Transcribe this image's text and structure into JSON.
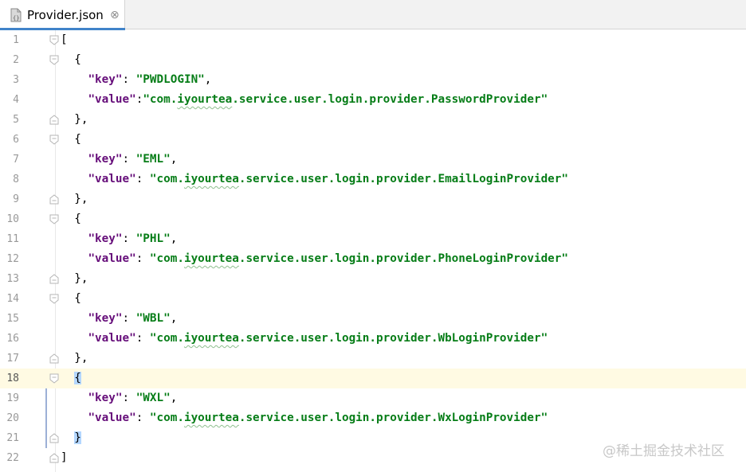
{
  "tab": {
    "filename": "Provider.json",
    "close": "⊗"
  },
  "lines": [
    {
      "n": "1",
      "t": [
        {
          "c": "p",
          "v": "["
        }
      ],
      "fold": "open"
    },
    {
      "n": "2",
      "t": [
        {
          "c": "p",
          "v": "  {"
        }
      ],
      "fold": "open"
    },
    {
      "n": "3",
      "t": [
        {
          "c": "p",
          "v": "    "
        },
        {
          "c": "k",
          "v": "\"key\""
        },
        {
          "c": "p",
          "v": ": "
        },
        {
          "c": "s",
          "v": "\"PWDLOGIN\""
        },
        {
          "c": "p",
          "v": ","
        }
      ]
    },
    {
      "n": "4",
      "t": [
        {
          "c": "p",
          "v": "    "
        },
        {
          "c": "k",
          "v": "\"value\""
        },
        {
          "c": "p",
          "v": ":"
        },
        {
          "c": "s",
          "v": "\"com."
        },
        {
          "c": "sw",
          "v": "iyourtea"
        },
        {
          "c": "s",
          "v": ".service.user.login.provider.PasswordProvider\""
        }
      ]
    },
    {
      "n": "5",
      "t": [
        {
          "c": "p",
          "v": "  },"
        }
      ],
      "fold": "close"
    },
    {
      "n": "6",
      "t": [
        {
          "c": "p",
          "v": "  {"
        }
      ],
      "fold": "open"
    },
    {
      "n": "7",
      "t": [
        {
          "c": "p",
          "v": "    "
        },
        {
          "c": "k",
          "v": "\"key\""
        },
        {
          "c": "p",
          "v": ": "
        },
        {
          "c": "s",
          "v": "\"EML\""
        },
        {
          "c": "p",
          "v": ","
        }
      ]
    },
    {
      "n": "8",
      "t": [
        {
          "c": "p",
          "v": "    "
        },
        {
          "c": "k",
          "v": "\"value\""
        },
        {
          "c": "p",
          "v": ": "
        },
        {
          "c": "s",
          "v": "\"com."
        },
        {
          "c": "sw",
          "v": "iyourtea"
        },
        {
          "c": "s",
          "v": ".service.user.login.provider.EmailLoginProvider\""
        }
      ]
    },
    {
      "n": "9",
      "t": [
        {
          "c": "p",
          "v": "  },"
        }
      ],
      "fold": "close"
    },
    {
      "n": "10",
      "t": [
        {
          "c": "p",
          "v": "  {"
        }
      ],
      "fold": "open"
    },
    {
      "n": "11",
      "t": [
        {
          "c": "p",
          "v": "    "
        },
        {
          "c": "k",
          "v": "\"key\""
        },
        {
          "c": "p",
          "v": ": "
        },
        {
          "c": "s",
          "v": "\"PHL\""
        },
        {
          "c": "p",
          "v": ","
        }
      ]
    },
    {
      "n": "12",
      "t": [
        {
          "c": "p",
          "v": "    "
        },
        {
          "c": "k",
          "v": "\"value\""
        },
        {
          "c": "p",
          "v": ": "
        },
        {
          "c": "s",
          "v": "\"com."
        },
        {
          "c": "sw",
          "v": "iyourtea"
        },
        {
          "c": "s",
          "v": ".service.user.login.provider.PhoneLoginProvider\""
        }
      ]
    },
    {
      "n": "13",
      "t": [
        {
          "c": "p",
          "v": "  },"
        }
      ],
      "fold": "close"
    },
    {
      "n": "14",
      "t": [
        {
          "c": "p",
          "v": "  {"
        }
      ],
      "fold": "open"
    },
    {
      "n": "15",
      "t": [
        {
          "c": "p",
          "v": "    "
        },
        {
          "c": "k",
          "v": "\"key\""
        },
        {
          "c": "p",
          "v": ": "
        },
        {
          "c": "s",
          "v": "\"WBL\""
        },
        {
          "c": "p",
          "v": ","
        }
      ]
    },
    {
      "n": "16",
      "t": [
        {
          "c": "p",
          "v": "    "
        },
        {
          "c": "k",
          "v": "\"value\""
        },
        {
          "c": "p",
          "v": ": "
        },
        {
          "c": "s",
          "v": "\"com."
        },
        {
          "c": "sw",
          "v": "iyourtea"
        },
        {
          "c": "s",
          "v": ".service.user.login.provider.WbLoginProvider\""
        }
      ]
    },
    {
      "n": "17",
      "t": [
        {
          "c": "p",
          "v": "  },"
        }
      ],
      "fold": "close"
    },
    {
      "n": "18",
      "t": [
        {
          "c": "p",
          "v": "  "
        },
        {
          "c": "ph",
          "v": "{"
        }
      ],
      "fold": "open",
      "current": true
    },
    {
      "n": "19",
      "t": [
        {
          "c": "p",
          "v": "    "
        },
        {
          "c": "k",
          "v": "\"key\""
        },
        {
          "c": "p",
          "v": ": "
        },
        {
          "c": "s",
          "v": "\"WXL\""
        },
        {
          "c": "p",
          "v": ","
        }
      ]
    },
    {
      "n": "20",
      "t": [
        {
          "c": "p",
          "v": "    "
        },
        {
          "c": "k",
          "v": "\"value\""
        },
        {
          "c": "p",
          "v": ": "
        },
        {
          "c": "s",
          "v": "\"com."
        },
        {
          "c": "sw",
          "v": "iyourtea"
        },
        {
          "c": "s",
          "v": ".service.user.login.provider.WxLoginProvider\""
        }
      ]
    },
    {
      "n": "21",
      "t": [
        {
          "c": "p",
          "v": "  "
        },
        {
          "c": "ph",
          "v": "}"
        }
      ],
      "fold": "close"
    },
    {
      "n": "22",
      "t": [
        {
          "c": "p",
          "v": "]"
        }
      ],
      "fold": "close"
    }
  ],
  "watermark": "@稀土掘金技术社区",
  "colors": {
    "key": "#660e7a",
    "string": "#067d17",
    "current_line": "#fffae3",
    "brace_match": "#b4d7ff",
    "tab_accent": "#4083c9"
  }
}
